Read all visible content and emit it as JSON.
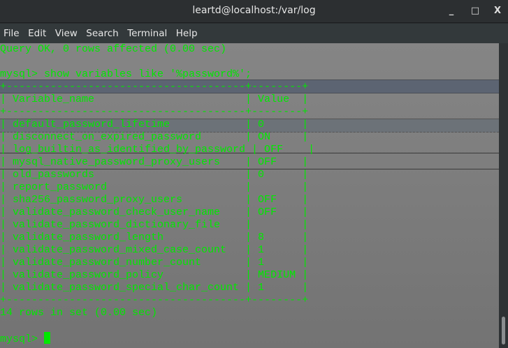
{
  "window": {
    "title": "leartd@localhost:/var/log",
    "minimize": "_",
    "maximize": "□",
    "close": "X"
  },
  "menu": [
    "File",
    "Edit",
    "View",
    "Search",
    "Terminal",
    "Help"
  ],
  "terminal": {
    "query_ok": "Query OK, 0 rows affected (0.00 sec)",
    "command": "mysql> show variables like '%password%';",
    "border": "+--------------------------------------+--------+",
    "header": "| Variable_name                        | Value  |",
    "rows": [
      "| default_password_lifetime            | 0      |",
      "| disconnect_on_expired_password       | ON     |",
      "| log_builtin_as_identified_by_password | OFF    |",
      "| mysql_native_password_proxy_users    | OFF    |",
      "| old_passwords                        | 0      |",
      "| report_password                      |        |",
      "| sha256_password_proxy_users          | OFF    |",
      "| validate_password_check_user_name    | OFF    |",
      "| validate_password_dictionary_file    |        |",
      "| validate_password_length             | 8      |",
      "| validate_password_mixed_case_count   | 1      |",
      "| validate_password_number_count       | 1      |",
      "| validate_password_policy             | MEDIUM |",
      "| validate_password_special_char_count | 1      |"
    ],
    "summary": "14 rows in set (0.00 sec)",
    "prompt": "mysql> "
  }
}
